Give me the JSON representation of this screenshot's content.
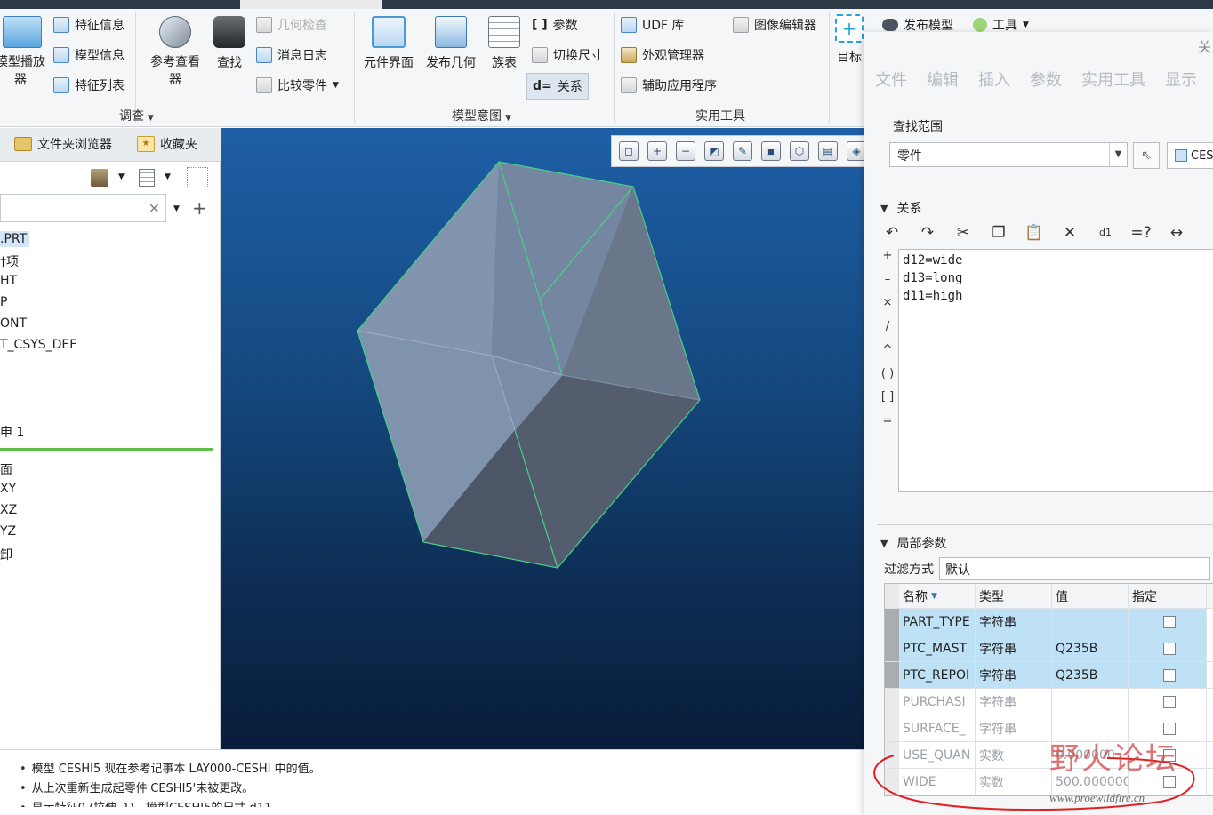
{
  "ribbon": {
    "model_player": "模型播放器",
    "feature_info": "特征信息",
    "model_info": "模型信息",
    "feature_list": "特征列表",
    "ref_viewer": "参考查看器",
    "find": "查找",
    "geometry_check": "几何检查",
    "message_log": "消息日志",
    "compare_part": "比较零件",
    "investigate_group": "调查",
    "component_interface": "元件界面",
    "publish_geometry": "发布几何",
    "family_table": "族表",
    "parameters": "参数",
    "switch_dimensions": "切换尺寸",
    "relations": "关系",
    "model_intent_group": "模型意图",
    "udf_library": "UDF 库",
    "appearance_manager": "外观管理器",
    "aux_applications": "辅助应用程序",
    "image_editor": "图像编辑器",
    "utilities_group": "实用工具",
    "publish_model": "发布模型",
    "tools": "工具",
    "target": "目标"
  },
  "navigator": {
    "tab_folder_browser": "文件夹浏览器",
    "tab_favorites": "收藏夹",
    "tree": [
      ".PRT",
      "†项",
      "HT",
      "P",
      "ONT",
      "T_CSYS_DEF",
      "申 1",
      "面",
      "XY",
      "XZ",
      "YZ",
      "卸"
    ]
  },
  "messages": [
    "模型 CESHI5 现在参考记事本 LAY000-CESHI 中的值。",
    "从上次重新生成起零件'CESHI5'未被更改。",
    "显示特征0 (拉伸_1)，模型CESHI5的尺寸 d11"
  ],
  "dialog": {
    "close": "关",
    "menu": [
      "文件",
      "编辑",
      "插入",
      "参数",
      "实用工具",
      "显示"
    ],
    "scope_label": "查找范围",
    "scope_value": "零件",
    "ces_label": "CES",
    "relations_section": "关系",
    "side_ops": [
      "+",
      "–",
      "×",
      "/",
      "^",
      "( )",
      "[ ]",
      "="
    ],
    "relations": [
      "d12=wide",
      "d13=long",
      "d11=high"
    ],
    "local_params_section": "局部参数",
    "filter_label": "过滤方式",
    "filter_value": "默认",
    "table_headers": [
      "名称",
      "类型",
      "值",
      "指定"
    ],
    "params": [
      {
        "name": "PART_TYPE",
        "type": "字符串",
        "value": "",
        "highlight": true
      },
      {
        "name": "PTC_MAST",
        "type": "字符串",
        "value": "Q235B",
        "highlight": true
      },
      {
        "name": "PTC_REPOI",
        "type": "字符串",
        "value": "Q235B",
        "highlight": true
      },
      {
        "name": "PURCHASI",
        "type": "字符串",
        "value": "",
        "highlight": false
      },
      {
        "name": "SURFACE_",
        "type": "字符串",
        "value": "",
        "highlight": false
      },
      {
        "name": "USE_QUAN",
        "type": "实数",
        "value": "0.000000",
        "highlight": false
      },
      {
        "name": "WIDE",
        "type": "实数",
        "value": "500.000000",
        "highlight": false
      }
    ]
  },
  "watermark": {
    "text": "野火论坛",
    "url": "www.proewildfire.cn"
  },
  "colors": {
    "viewport_top": "#1e5fa6",
    "viewport_bottom": "#081d3a",
    "part_edge": "#46d18a",
    "selection": "#bfe1f6",
    "annotation": "#e02020"
  }
}
